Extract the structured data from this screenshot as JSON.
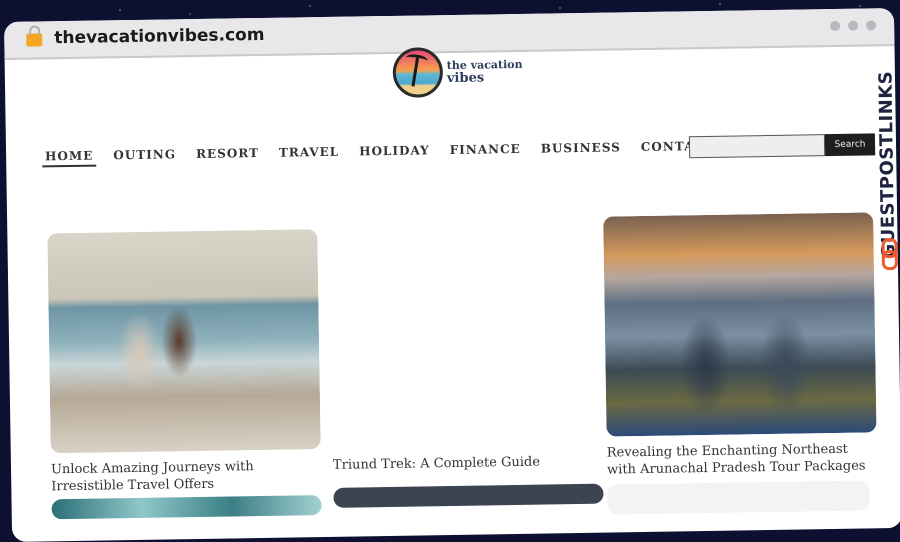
{
  "browser": {
    "url": "thevacationvibes.com",
    "lock_icon": "lock-icon",
    "window_controls": [
      "dot",
      "dot",
      "dot"
    ]
  },
  "site": {
    "logo_line1": "the vacation",
    "logo_line2": "vibes"
  },
  "nav": {
    "items": [
      {
        "label": "HOME",
        "active": true
      },
      {
        "label": "OUTING"
      },
      {
        "label": "RESORT"
      },
      {
        "label": "TRAVEL"
      },
      {
        "label": "HOLIDAY"
      },
      {
        "label": "FINANCE"
      },
      {
        "label": "BUSINESS"
      },
      {
        "label": "CONTACT US"
      }
    ]
  },
  "search": {
    "value": "",
    "button_label": "Search"
  },
  "posts": [
    {
      "title": "Unlock Amazing Journeys with Irresistible Travel Offers",
      "image": "horse-riding-beach"
    },
    {
      "title": "Triund Trek: A Complete Guide",
      "image": "none"
    },
    {
      "title": "Revealing the Enchanting Northeast with Arunachal Pradesh Tour Packages",
      "image": "couple-mountain-sunset"
    }
  ],
  "watermark": {
    "text": "GUESTPOSTLINKS",
    "icon": "chain-link-icon",
    "accent": "#ef5a2e"
  }
}
